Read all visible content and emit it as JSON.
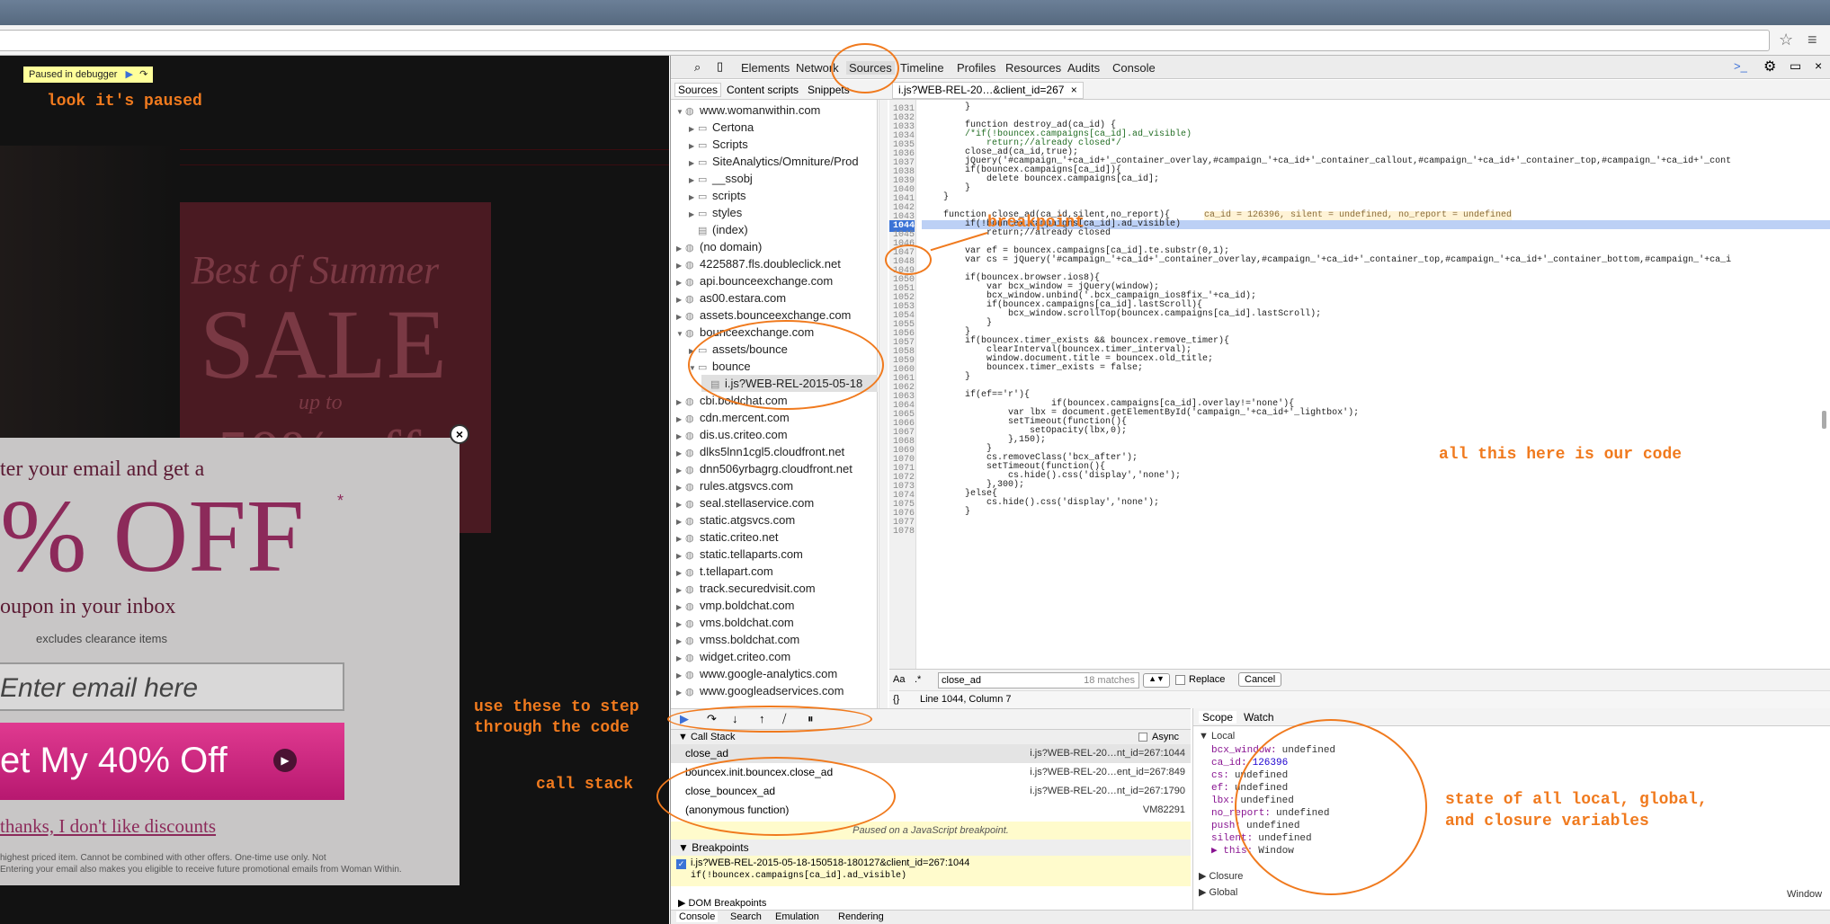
{
  "page": {
    "paused_label": "Paused in debugger",
    "sale_line1": "Best of Summer",
    "sale_line2": "SALE",
    "sale_line3": "up to",
    "sale_line4": "50% off",
    "modal": {
      "line1": "ter your email and get a",
      "big": "% OFF",
      "asterisk": "*",
      "line2": "oupon in your inbox",
      "excludes": "excludes clearance items",
      "email_placeholder": "Enter email here",
      "cta": "et My 40% Off",
      "decline": "thanks, I don't like discounts",
      "fine1": "highest priced item. Cannot be combined with other offers. One-time use only. Not",
      "fine2": "Entering your email also makes you eligible to receive future promotional emails from Woman Within."
    }
  },
  "devtools": {
    "tabs": [
      "Elements",
      "Network",
      "Sources",
      "Timeline",
      "Profiles",
      "Resources",
      "Audits",
      "Console"
    ],
    "subtabs": [
      "Sources",
      "Content scripts",
      "Snippets"
    ],
    "file_tab": "i.js?WEB-REL-20…&client_id=267",
    "nav": [
      {
        "label": "www.womanwithin.com",
        "type": "domain",
        "open": true,
        "indent": 0
      },
      {
        "label": "Certona",
        "type": "folder",
        "indent": 1
      },
      {
        "label": "Scripts",
        "type": "folder",
        "indent": 1
      },
      {
        "label": "SiteAnalytics/Omniture/Prod",
        "type": "folder",
        "indent": 1
      },
      {
        "label": "__ssobj",
        "type": "folder",
        "indent": 1
      },
      {
        "label": "scripts",
        "type": "folder",
        "indent": 1
      },
      {
        "label": "styles",
        "type": "folder",
        "indent": 1
      },
      {
        "label": "(index)",
        "type": "file",
        "indent": 1
      },
      {
        "label": "(no domain)",
        "type": "domain",
        "indent": 0
      },
      {
        "label": "4225887.fls.doubleclick.net",
        "type": "domain",
        "indent": 0
      },
      {
        "label": "api.bounceexchange.com",
        "type": "domain",
        "indent": 0
      },
      {
        "label": "as00.estara.com",
        "type": "domain",
        "indent": 0
      },
      {
        "label": "assets.bounceexchange.com",
        "type": "domain",
        "indent": 0
      },
      {
        "label": "bounceexchange.com",
        "type": "domain",
        "open": true,
        "indent": 0
      },
      {
        "label": "assets/bounce",
        "type": "folder",
        "indent": 1
      },
      {
        "label": "bounce",
        "type": "folder",
        "open": true,
        "indent": 1
      },
      {
        "label": "i.js?WEB-REL-2015-05-18",
        "type": "file",
        "selected": true,
        "indent": 2
      },
      {
        "label": "cbi.boldchat.com",
        "type": "domain",
        "indent": 0
      },
      {
        "label": "cdn.mercent.com",
        "type": "domain",
        "indent": 0
      },
      {
        "label": "dis.us.criteo.com",
        "type": "domain",
        "indent": 0
      },
      {
        "label": "dlks5lnn1cgl5.cloudfront.net",
        "type": "domain",
        "indent": 0
      },
      {
        "label": "dnn506yrbagrg.cloudfront.net",
        "type": "domain",
        "indent": 0
      },
      {
        "label": "rules.atgsvcs.com",
        "type": "domain",
        "indent": 0
      },
      {
        "label": "seal.stellaservice.com",
        "type": "domain",
        "indent": 0
      },
      {
        "label": "static.atgsvcs.com",
        "type": "domain",
        "indent": 0
      },
      {
        "label": "static.criteo.net",
        "type": "domain",
        "indent": 0
      },
      {
        "label": "static.tellaparts.com",
        "type": "domain",
        "indent": 0
      },
      {
        "label": "t.tellapart.com",
        "type": "domain",
        "indent": 0
      },
      {
        "label": "track.securedvisit.com",
        "type": "domain",
        "indent": 0
      },
      {
        "label": "vmp.boldchat.com",
        "type": "domain",
        "indent": 0
      },
      {
        "label": "vms.boldchat.com",
        "type": "domain",
        "indent": 0
      },
      {
        "label": "vmss.boldchat.com",
        "type": "domain",
        "indent": 0
      },
      {
        "label": "widget.criteo.com",
        "type": "domain",
        "indent": 0
      },
      {
        "label": "www.google-analytics.com",
        "type": "domain",
        "indent": 0
      },
      {
        "label": "www.googleadservices.com",
        "type": "domain",
        "indent": 0
      }
    ],
    "code": [
      {
        "n": "1031",
        "t": "        }"
      },
      {
        "n": "1032",
        "t": ""
      },
      {
        "n": "1033",
        "t": "        function destroy_ad(ca_id) {"
      },
      {
        "n": "1034",
        "t": "        /*if(!bouncex.campaigns[ca_id].ad_visible)"
      },
      {
        "n": "1035",
        "t": "            return;//already closed*/"
      },
      {
        "n": "1036",
        "t": "        close_ad(ca_id,true);"
      },
      {
        "n": "1037",
        "t": "        jQuery('#campaign_'+ca_id+'_container_overlay,#campaign_'+ca_id+'_container_callout,#campaign_'+ca_id+'_container_top,#campaign_'+ca_id+'_cont"
      },
      {
        "n": "1038",
        "t": "        if(bouncex.campaigns[ca_id]){"
      },
      {
        "n": "1039",
        "t": "            delete bouncex.campaigns[ca_id];"
      },
      {
        "n": "1040",
        "t": "        }"
      },
      {
        "n": "1041",
        "t": "    }"
      },
      {
        "n": "1042",
        "t": ""
      },
      {
        "n": "1043",
        "t": "    function close_ad(ca_id,silent,no_report){"
      },
      {
        "n": "1044",
        "t": "        if(!bouncex.campaigns[ca_id].ad_visible)"
      },
      {
        "n": "1045",
        "t": "            return;//already closed"
      },
      {
        "n": "1046",
        "t": ""
      },
      {
        "n": "1047",
        "t": "        var ef = bouncex.campaigns[ca_id].te.substr(0,1);"
      },
      {
        "n": "1048",
        "t": "        var cs = jQuery('#campaign_'+ca_id+'_container_overlay,#campaign_'+ca_id+'_container_top,#campaign_'+ca_id+'_container_bottom,#campaign_'+ca_i"
      },
      {
        "n": "1049",
        "t": ""
      },
      {
        "n": "1050",
        "t": "        if(bouncex.browser.ios8){"
      },
      {
        "n": "1051",
        "t": "            var bcx_window = jQuery(window);"
      },
      {
        "n": "1052",
        "t": "            bcx_window.unbind('.bcx_campaign_ios8fix_'+ca_id);"
      },
      {
        "n": "1053",
        "t": "            if(bouncex.campaigns[ca_id].lastScroll){"
      },
      {
        "n": "1054",
        "t": "                bcx_window.scrollTop(bouncex.campaigns[ca_id].lastScroll);"
      },
      {
        "n": "1055",
        "t": "            }"
      },
      {
        "n": "1056",
        "t": "        }"
      },
      {
        "n": "1057",
        "t": "        if(bouncex.timer_exists && bouncex.remove_timer){"
      },
      {
        "n": "1058",
        "t": "            clearInterval(bouncex.timer_interval);"
      },
      {
        "n": "1059",
        "t": "            window.document.title = bouncex.old_title;"
      },
      {
        "n": "1060",
        "t": "            bouncex.timer_exists = false;"
      },
      {
        "n": "1061",
        "t": "        }"
      },
      {
        "n": "1062",
        "t": ""
      },
      {
        "n": "1063",
        "t": "        if(ef=='r'){"
      },
      {
        "n": "1064",
        "t": "                        if(bouncex.campaigns[ca_id].overlay!='none'){"
      },
      {
        "n": "1065",
        "t": "                var lbx = document.getElementById('campaign_'+ca_id+'_lightbox');"
      },
      {
        "n": "1066",
        "t": "                setTimeout(function(){"
      },
      {
        "n": "1067",
        "t": "                    setOpacity(lbx,0);"
      },
      {
        "n": "1068",
        "t": "                },150);"
      },
      {
        "n": "1069",
        "t": "            }"
      },
      {
        "n": "1070",
        "t": "            cs.removeClass('bcx_after');"
      },
      {
        "n": "1071",
        "t": "            setTimeout(function(){"
      },
      {
        "n": "1072",
        "t": "                cs.hide().css('display','none');"
      },
      {
        "n": "1073",
        "t": "            },300);"
      },
      {
        "n": "1074",
        "t": "        }else{"
      },
      {
        "n": "1075",
        "t": "            cs.hide().css('display','none');"
      },
      {
        "n": "1076",
        "t": "        }"
      },
      {
        "n": "1077",
        "t": ""
      },
      {
        "n": "1078",
        "t": ""
      }
    ],
    "inline_values": "ca_id = 126396, silent = undefined, no_report = undefined",
    "search": {
      "value": "close_ad",
      "matches": "18 matches",
      "replace_label": "Replace",
      "cancel": "Cancel",
      "aa": "Aa",
      ".*": ".*"
    },
    "status": {
      "braces": "{}",
      "position": "Line 1044, Column 7"
    },
    "callstack": {
      "header": "Call Stack",
      "async": "Async",
      "rows": [
        {
          "fn": "close_ad",
          "loc": "i.js?WEB-REL-20…nt_id=267:1044"
        },
        {
          "fn": "bouncex.init.bouncex.close_ad",
          "loc": "i.js?WEB-REL-20…ent_id=267:849"
        },
        {
          "fn": "close_bouncex_ad",
          "loc": "i.js?WEB-REL-20…nt_id=267:1790"
        },
        {
          "fn": "(anonymous function)",
          "loc": "VM82291"
        }
      ],
      "paused": "Paused on a JavaScript breakpoint."
    },
    "breakpoints": {
      "header": "Breakpoints",
      "file": "i.js?WEB-REL-2015-05-18-150518-180127&client_id=267:1044",
      "code": "if(!bouncex.campaigns[ca_id].ad_visible)",
      "dom": "DOM Breakpoints"
    },
    "bottom_tabs": [
      "Console",
      "Search",
      "Emulation",
      "Rendering"
    ],
    "scope": {
      "tabs": [
        "Scope",
        "Watch"
      ],
      "local": "Local",
      "vars": [
        {
          "k": "bcx_window:",
          "v": "undefined"
        },
        {
          "k": "ca_id:",
          "v": "126396"
        },
        {
          "k": "cs:",
          "v": "undefined"
        },
        {
          "k": "ef:",
          "v": "undefined"
        },
        {
          "k": "lbx:",
          "v": "undefined"
        },
        {
          "k": "no_report:",
          "v": "undefined"
        },
        {
          "k": "push:",
          "v": "undefined"
        },
        {
          "k": "silent:",
          "v": "undefined"
        },
        {
          "k": "▶ this:",
          "v": "Window"
        }
      ],
      "closure": "Closure",
      "global": "Global",
      "global_val": "Window"
    }
  },
  "annotations": {
    "paused": "look it's paused",
    "breakpoint": "breakpoint",
    "ourcode": "all this here is our code",
    "step1": "use these to step",
    "step2": "through the code",
    "callstack": "call stack",
    "state1": "state of all local, global,",
    "state2": "and closure variables"
  },
  "colors": {
    "annotation": "#f07a1e",
    "highlight": "#4c86d6"
  }
}
